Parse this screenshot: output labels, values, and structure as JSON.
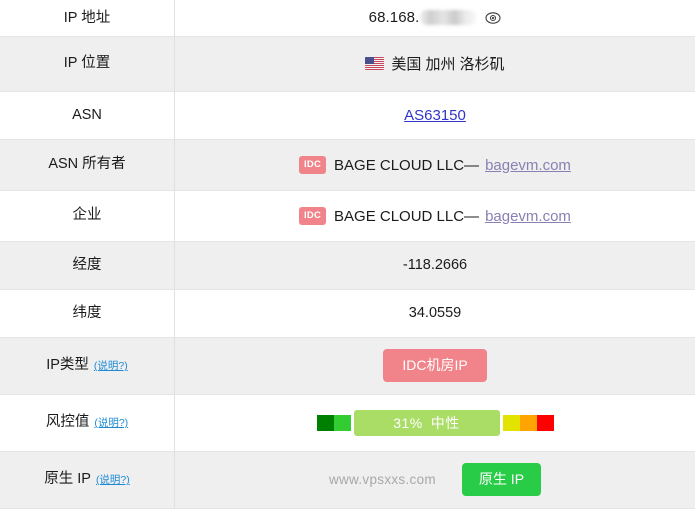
{
  "table": {
    "rows": [
      {
        "key": "ip-address",
        "label": "IP 地址",
        "help": null,
        "value_prefix": "68.168.",
        "masked": true,
        "eye_icon": "eye-icon"
      },
      {
        "key": "ip-location",
        "label": "IP 位置",
        "help": null,
        "flag": "us-flag-icon",
        "location": "美国 加州 洛杉矶"
      },
      {
        "key": "asn",
        "label": "ASN",
        "help": null,
        "asn": "AS63150"
      },
      {
        "key": "asn-owner",
        "label": "ASN 所有者",
        "help": null,
        "tag": "IDC",
        "org": "BAGE CLOUD LLC—",
        "org_link": "bagevm.com"
      },
      {
        "key": "enterprise",
        "label": "企业",
        "help": null,
        "tag": "IDC",
        "org": "BAGE CLOUD LLC—",
        "org_link": "bagevm.com"
      },
      {
        "key": "longitude",
        "label": "经度",
        "help": null,
        "value": "-118.2666"
      },
      {
        "key": "latitude",
        "label": "纬度",
        "help": null,
        "value": "34.0559"
      },
      {
        "key": "ip-type",
        "label": "IP类型",
        "help": "(说明?)",
        "pill": "IDC机房IP"
      },
      {
        "key": "risk-score",
        "label": "风控值",
        "help": "(说明?)",
        "risk_percent": "31%",
        "risk_level": "中性"
      },
      {
        "key": "native-ip",
        "label": "原生 IP",
        "help": "(说明?)",
        "watermark": "www.vpsxxs.com",
        "pill": "原生 IP"
      }
    ]
  },
  "risk_meter": {
    "segments": [
      "#008000",
      "#33cc33",
      "#e3e300",
      "#ffa400",
      "#ff0000"
    ],
    "active_color": "#aadd66",
    "percent": "31%",
    "level": "中性"
  },
  "colors": {
    "idc_tag": "#f0848a",
    "native_pill": "#29cc46",
    "help_link": "#1e8bd6",
    "asn_link": "#2f36c9",
    "org_link": "#8a7fb3",
    "row_alt_bg": "#efefef",
    "row_bg": "#ffffff",
    "border": "#e4e4e4"
  }
}
